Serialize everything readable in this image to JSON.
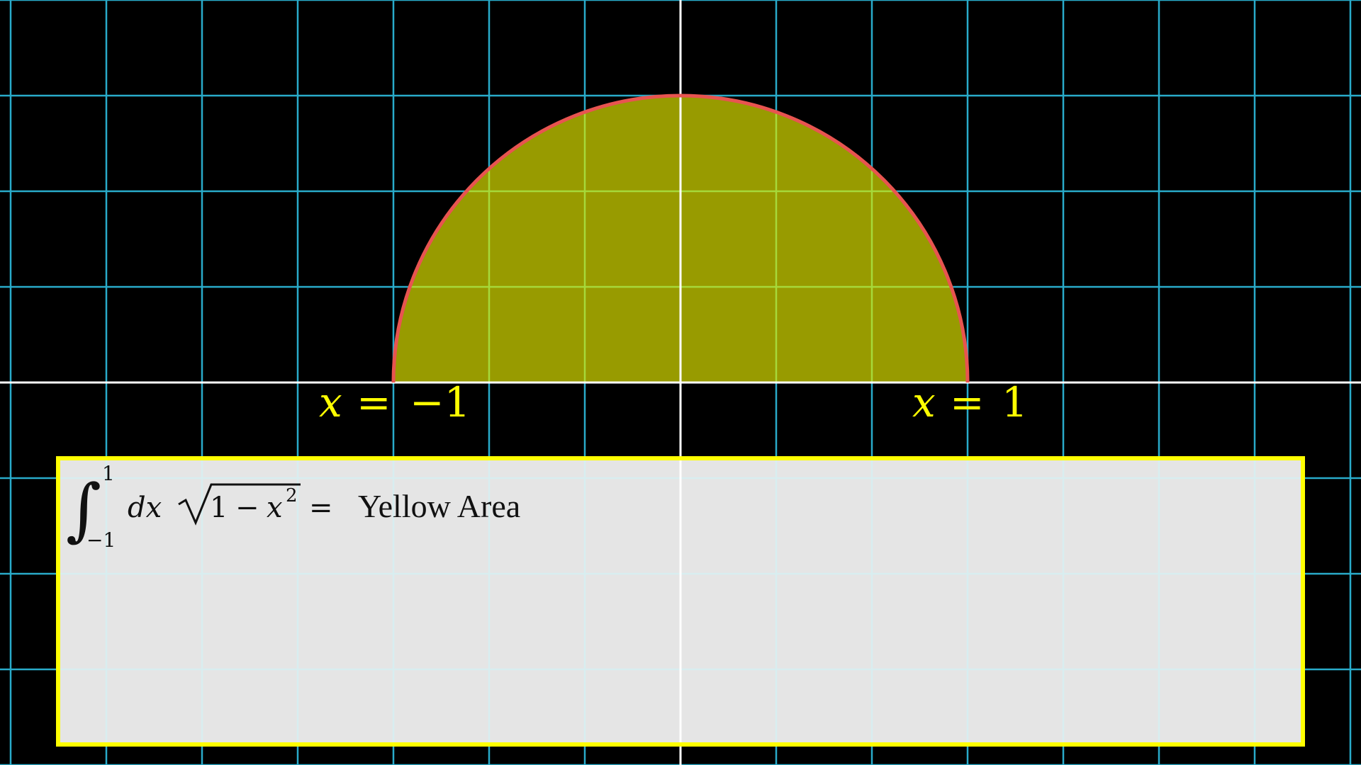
{
  "labels": {
    "left_bound": {
      "var": "x",
      "op": "=",
      "val": "−1"
    },
    "right_bound": {
      "var": "x",
      "op": "=",
      "val": "1"
    }
  },
  "equation": {
    "upper_limit": "1",
    "lower_limit": "−1",
    "differential": "dx",
    "radicand_const": "1",
    "radicand_minus": "−",
    "radicand_var": "x",
    "radicand_exp": "2",
    "equals": "=",
    "result_text": "Yellow Area"
  },
  "colors": {
    "background": "#000000",
    "grid": "#29ABCA",
    "axes": "#FFFFFF",
    "area_fill": "#989B00",
    "curve": "#E85450",
    "label": "#FFFF00",
    "box_fill": "#E5E5E5",
    "box_border": "#FFFF00"
  }
}
